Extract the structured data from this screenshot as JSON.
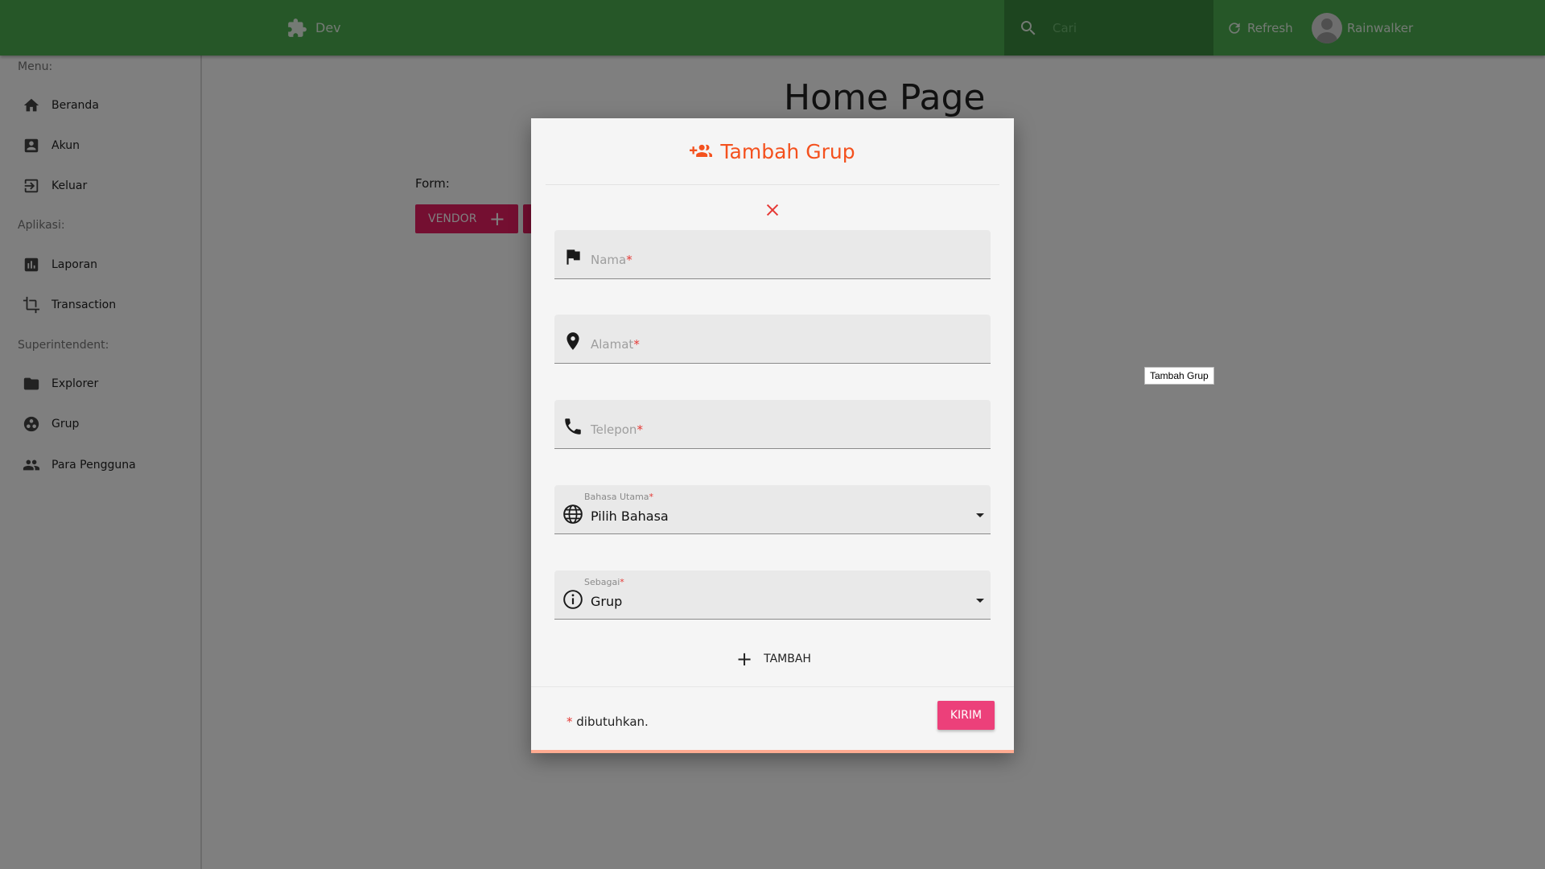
{
  "topbar": {
    "brand_label": "Dev",
    "search_placeholder": "Cari",
    "refresh_label": "Refresh",
    "username": "Rainwalker",
    "bar_color": "#4caf50"
  },
  "sidebar": {
    "sections": [
      {
        "label": "Menu:",
        "items": [
          {
            "label": "Beranda",
            "icon": "home-icon"
          },
          {
            "label": "Akun",
            "icon": "account-box-icon"
          },
          {
            "label": "Keluar",
            "icon": "exit-icon"
          }
        ]
      },
      {
        "label": "Aplikasi:",
        "items": [
          {
            "label": "Laporan",
            "icon": "chart-icon"
          },
          {
            "label": "Transaction",
            "icon": "crop-icon"
          }
        ]
      },
      {
        "label": "Superintendent:",
        "items": [
          {
            "label": "Explorer",
            "icon": "folder-icon"
          },
          {
            "label": "Grup",
            "icon": "group-work-icon"
          },
          {
            "label": "Para Pengguna",
            "icon": "people-icon"
          }
        ]
      }
    ]
  },
  "main": {
    "title": "Home Page",
    "form_label": "Form:",
    "vendor_button": "VENDOR"
  },
  "tooltip": "Tambah Grup",
  "modal": {
    "title": "Tambah Grup",
    "fields": [
      {
        "placeholder": "Nama",
        "required_mark": "*",
        "icon": "flag-icon"
      },
      {
        "placeholder": "Alamat",
        "required_mark": "*",
        "icon": "location-pin-icon"
      },
      {
        "placeholder": "Telepon",
        "required_mark": "*",
        "icon": "phone-icon"
      }
    ],
    "selects": [
      {
        "label": "Bahasa Utama",
        "required_mark": "*",
        "value": "Pilih Bahasa",
        "icon": "globe-icon"
      },
      {
        "label": "Sebagai",
        "required_mark": "*",
        "value": "Grup",
        "icon": "info-icon"
      }
    ],
    "add_label": "TAMBAH",
    "required_note_mark": "*",
    "required_note": "dibutuhkan.",
    "submit_label": "KIRIM",
    "accent_color": "#f4511e",
    "submit_color": "#ec407a"
  }
}
